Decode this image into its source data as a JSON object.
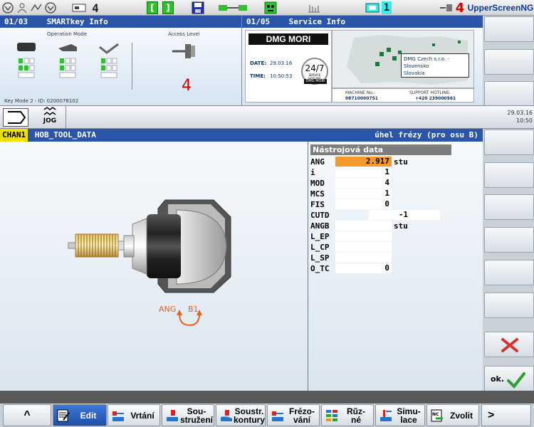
{
  "topbar": {
    "channel_slot": "4",
    "nc_count": "1",
    "access_level": "4",
    "upper_screen": "UpperScreenNG"
  },
  "smartkey": {
    "title_num": "01/03",
    "title": "SMARTkey Info",
    "operation_mode": "Operation Mode",
    "access_level": "Access Level",
    "level_value": "4",
    "key_mode": "Key Mode 2 - ID: 0200078102"
  },
  "service": {
    "title_num": "01/05",
    "title": "Service Info",
    "brand": "DMG MORI",
    "date_label": "DATE:",
    "date_value": "29.03.16",
    "time_label": "TIME:",
    "time_value": "10:50:53",
    "badge": "24/7",
    "badge_sub": "SERVICE HOTLINE",
    "badge_brand": "DMG MORI",
    "company": [
      "DMG Czech s.r.o. -",
      "Slovensko",
      "Slovakia"
    ],
    "machine_no_label": "MACHINE No.:",
    "machine_no": "08710000751",
    "hotline_label": "SUPPORT HOTLINE:",
    "hotline": "+420 239000561"
  },
  "mode": {
    "jog_label": "JOG",
    "date": "29.03.16",
    "time": "10:50"
  },
  "channel": {
    "name": "CHAN1",
    "program": "HOB_TOOL_DATA",
    "hint": "úhel frézy (pro osu B)"
  },
  "graphic": {
    "ang_label": "ANG",
    "b_label": "B1"
  },
  "params": {
    "header": "Nástrojová data",
    "rows": [
      {
        "label": "ANG",
        "value": "2.917",
        "unit": "stu"
      },
      {
        "label": "i",
        "value": "1",
        "unit": ""
      },
      {
        "label": "MOD",
        "value": "4",
        "unit": ""
      },
      {
        "label": "MCS",
        "value": "1",
        "unit": ""
      },
      {
        "label": "FIS",
        "value": "0",
        "unit": ""
      },
      {
        "label": "CUTD",
        "value": "-1",
        "unit": ""
      },
      {
        "label": "ANGB",
        "value": "",
        "unit": "stu"
      },
      {
        "label": "L_EP",
        "value": "",
        "unit": ""
      },
      {
        "label": "L_CP",
        "value": "",
        "unit": ""
      },
      {
        "label": "L_SP",
        "value": "",
        "unit": ""
      },
      {
        "label": "O_TC",
        "value": "0",
        "unit": ""
      }
    ]
  },
  "vsoft": {
    "ok_label": "ok."
  },
  "hsoft": {
    "up": "^",
    "edit": "Edit",
    "drilling": "Vrtání",
    "turning_1": "Sou-",
    "turning_2": "stružení",
    "contour_1": "Soustr.",
    "contour_2": "kontury",
    "milling_1": "Frézo-",
    "milling_2": "vání",
    "various_1": "Rŭz-",
    "various_2": "né",
    "sim_1": "Simu-",
    "sim_2": "lace",
    "select": "Zvolit",
    "next": ">"
  },
  "colors": {
    "title_blue": "#2a55a8",
    "highlight_orange": "#f59a2a",
    "chan_yellow": "#f0e000",
    "cancel_red": "#d93030",
    "ok_green": "#2aa02a",
    "level_red": "#cc0000"
  }
}
